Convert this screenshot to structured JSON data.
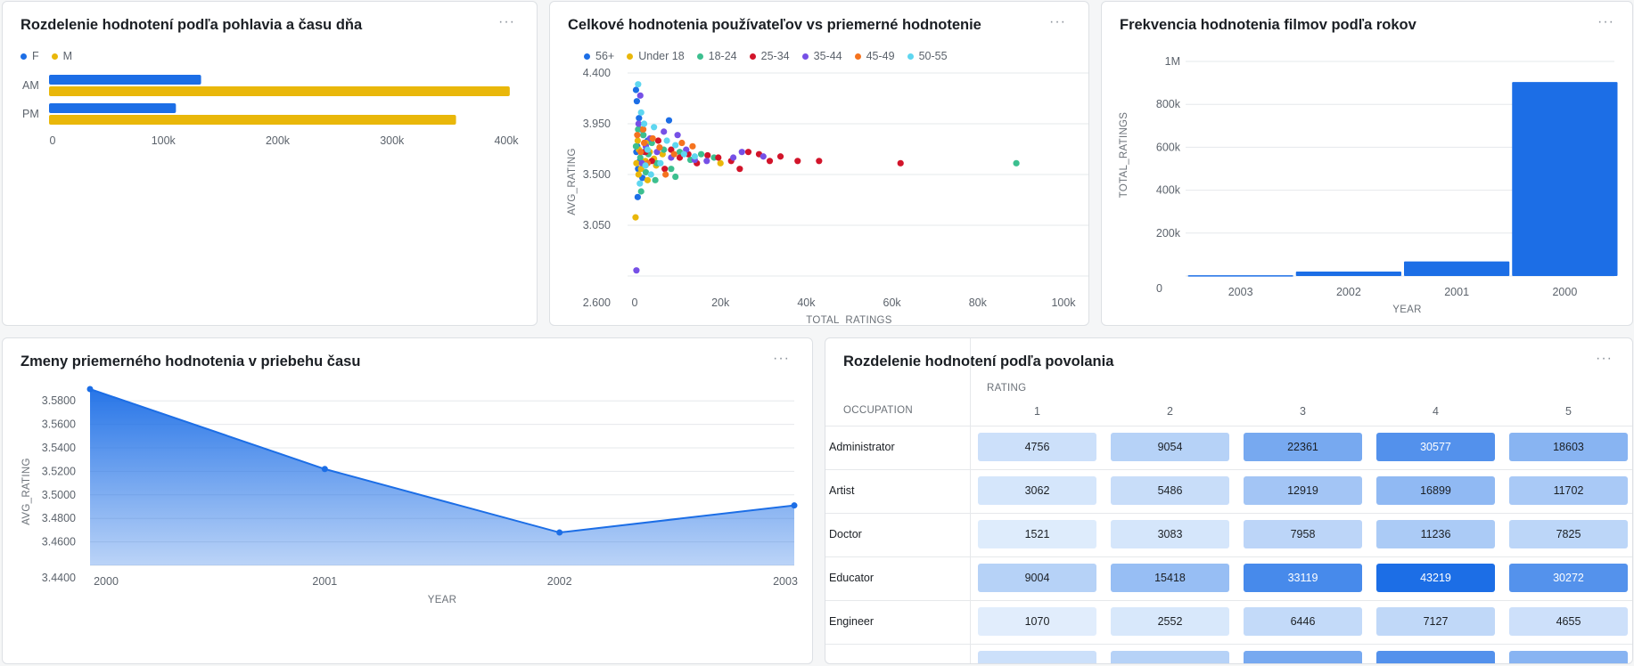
{
  "more_label": "···",
  "colors": {
    "blue": "#1c6ee6",
    "gold": "#e9b70a"
  },
  "gender_chart": {
    "title": "Rozdelenie hodnotení podľa pohlavia a času dňa",
    "chart_data": {
      "type": "bar",
      "orientation": "horizontal",
      "categories": [
        "AM",
        "PM"
      ],
      "series": [
        {
          "name": "F",
          "color": "#1c6ee6",
          "values": [
            133000,
            111000
          ]
        },
        {
          "name": "M",
          "color": "#e9b70a",
          "values": [
            403000,
            356000
          ]
        }
      ],
      "xlim": [
        0,
        400000
      ],
      "x_ticks": [
        "0",
        "100k",
        "200k",
        "300k",
        "400k"
      ],
      "legend": "top-left"
    }
  },
  "scatter_chart": {
    "title": "Celkové hodnotenia používateľov vs priemerné hodnotenie",
    "chart_data": {
      "type": "scatter",
      "xlabel": "TOTAL_RATINGS",
      "ylabel": "AVG_RATING",
      "xlim": [
        0,
        100000
      ],
      "ylim": [
        2.6,
        4.4
      ],
      "x_ticks": [
        "0",
        "20k",
        "40k",
        "60k",
        "80k",
        "100k"
      ],
      "y_ticks": [
        "2.600",
        "3.050",
        "3.500",
        "3.950",
        "4.400"
      ],
      "legend": "top-left",
      "series": [
        {
          "name": "56+",
          "color": "#1c6ee6",
          "points": [
            [
              300,
              4.25
            ],
            [
              500,
              4.15
            ],
            [
              1000,
              4.0
            ],
            [
              1500,
              3.9
            ],
            [
              600,
              3.75
            ],
            [
              1200,
              3.62
            ],
            [
              800,
              3.55
            ],
            [
              2000,
              3.85
            ],
            [
              400,
              3.7
            ],
            [
              1800,
              3.47
            ],
            [
              2500,
              3.58
            ],
            [
              3000,
              3.8
            ],
            [
              700,
              3.3
            ],
            [
              2200,
              3.7
            ],
            [
              8000,
              3.98
            ]
          ]
        },
        {
          "name": "Under 18",
          "color": "#e9b70a",
          "points": [
            [
              200,
              3.12
            ],
            [
              400,
              3.6
            ],
            [
              700,
              3.8
            ],
            [
              1000,
              3.72
            ],
            [
              1500,
              3.55
            ],
            [
              2500,
              3.62
            ],
            [
              3500,
              3.7
            ],
            [
              4500,
              3.64
            ],
            [
              1800,
              3.9
            ],
            [
              5000,
              3.58
            ],
            [
              3000,
              3.45
            ],
            [
              6500,
              3.68
            ],
            [
              20000,
              3.6
            ],
            [
              900,
              3.5
            ],
            [
              2800,
              3.78
            ]
          ]
        },
        {
          "name": "18-24",
          "color": "#3cbf8f",
          "points": [
            [
              300,
              3.75
            ],
            [
              800,
              3.9
            ],
            [
              1300,
              3.65
            ],
            [
              2000,
              3.85
            ],
            [
              2600,
              3.52
            ],
            [
              3200,
              3.68
            ],
            [
              4000,
              3.78
            ],
            [
              5200,
              3.6
            ],
            [
              6800,
              3.72
            ],
            [
              8500,
              3.55
            ],
            [
              10500,
              3.7
            ],
            [
              13000,
              3.63
            ],
            [
              15500,
              3.68
            ],
            [
              18500,
              3.65
            ],
            [
              1500,
              3.35
            ],
            [
              4800,
              3.45
            ],
            [
              9500,
              3.48
            ],
            [
              89000,
              3.6
            ]
          ]
        },
        {
          "name": "25-34",
          "color": "#d2142a",
          "points": [
            [
              2500,
              3.7
            ],
            [
              4000,
              3.62
            ],
            [
              5500,
              3.8
            ],
            [
              7000,
              3.55
            ],
            [
              8500,
              3.72
            ],
            [
              10500,
              3.65
            ],
            [
              12500,
              3.68
            ],
            [
              14500,
              3.6
            ],
            [
              17000,
              3.67
            ],
            [
              19500,
              3.65
            ],
            [
              22500,
              3.62
            ],
            [
              24500,
              3.55
            ],
            [
              26500,
              3.7
            ],
            [
              29000,
              3.68
            ],
            [
              31500,
              3.62
            ],
            [
              34000,
              3.66
            ],
            [
              38000,
              3.62
            ],
            [
              43000,
              3.62
            ],
            [
              62000,
              3.6
            ]
          ]
        },
        {
          "name": "35-44",
          "color": "#7650e6",
          "points": [
            [
              400,
              2.65
            ],
            [
              900,
              3.95
            ],
            [
              1700,
              3.6
            ],
            [
              2600,
              3.75
            ],
            [
              3600,
              3.82
            ],
            [
              5200,
              3.7
            ],
            [
              6800,
              3.88
            ],
            [
              8500,
              3.65
            ],
            [
              10000,
              3.85
            ],
            [
              12000,
              3.72
            ],
            [
              14000,
              3.63
            ],
            [
              16800,
              3.62
            ],
            [
              23000,
              3.65
            ],
            [
              25000,
              3.7
            ],
            [
              30000,
              3.66
            ],
            [
              1300,
              4.2
            ]
          ]
        },
        {
          "name": "45-49",
          "color": "#f5731f",
          "points": [
            [
              600,
              3.85
            ],
            [
              1400,
              3.7
            ],
            [
              2200,
              3.78
            ],
            [
              3000,
              3.6
            ],
            [
              4200,
              3.82
            ],
            [
              5800,
              3.74
            ],
            [
              7200,
              3.5
            ],
            [
              9200,
              3.68
            ],
            [
              11000,
              3.78
            ],
            [
              13500,
              3.75
            ],
            [
              2000,
              3.9
            ]
          ]
        },
        {
          "name": "50-55",
          "color": "#5ed6f0",
          "points": [
            [
              800,
              4.3
            ],
            [
              1500,
              4.05
            ],
            [
              2200,
              3.95
            ],
            [
              3000,
              3.72
            ],
            [
              4500,
              3.92
            ],
            [
              6000,
              3.6
            ],
            [
              7500,
              3.8
            ],
            [
              9500,
              3.76
            ],
            [
              11500,
              3.68
            ],
            [
              14000,
              3.66
            ],
            [
              1200,
              3.42
            ],
            [
              2500,
              3.58
            ],
            [
              3800,
              3.5
            ]
          ]
        }
      ]
    }
  },
  "year_freq_chart": {
    "title": "Frekvencia hodnotenia filmov podľa rokov",
    "chart_data": {
      "type": "bar",
      "categories": [
        "2003",
        "2002",
        "2001",
        "2000"
      ],
      "values": [
        3400,
        21000,
        68000,
        904000
      ],
      "xlabel": "YEAR",
      "ylabel": "TOTAL_RATINGS",
      "ylim": [
        0,
        1000000
      ],
      "y_ticks": [
        "0",
        "200k",
        "400k",
        "600k",
        "800k",
        "1M"
      ],
      "color": "#1c6ee6"
    }
  },
  "avg_trend_chart": {
    "title": "Zmeny priemerného hodnotenia v priebehu času",
    "chart_data": {
      "type": "area",
      "categories": [
        "2000",
        "2001",
        "2002",
        "2003"
      ],
      "values": [
        3.59,
        3.522,
        3.468,
        3.491
      ],
      "xlabel": "YEAR",
      "ylabel": "AVG_RATING",
      "ylim": [
        3.44,
        3.59
      ],
      "y_ticks": [
        "3.4400",
        "3.4600",
        "3.4800",
        "3.5000",
        "3.5200",
        "3.5400",
        "3.5600",
        "3.5800"
      ],
      "color": "#1c6ee6"
    }
  },
  "occupation_table": {
    "title": "Rozdelenie hodnotení podľa povolania",
    "rating_header": "RATING",
    "occupation_header": "OCCUPATION",
    "chart_data": {
      "type": "heatmap",
      "columns": [
        "1",
        "2",
        "3",
        "4",
        "5"
      ],
      "rows": [
        {
          "label": "Administrator",
          "values": [
            4756,
            9054,
            22361,
            30577,
            18603
          ]
        },
        {
          "label": "Artist",
          "values": [
            3062,
            5486,
            12919,
            16899,
            11702
          ]
        },
        {
          "label": "Doctor",
          "values": [
            1521,
            3083,
            7958,
            11236,
            7825
          ]
        },
        {
          "label": "Educator",
          "values": [
            9004,
            15418,
            33119,
            43219,
            30272
          ]
        },
        {
          "label": "Engineer",
          "values": [
            1070,
            2552,
            6446,
            7127,
            4655
          ]
        }
      ]
    }
  }
}
